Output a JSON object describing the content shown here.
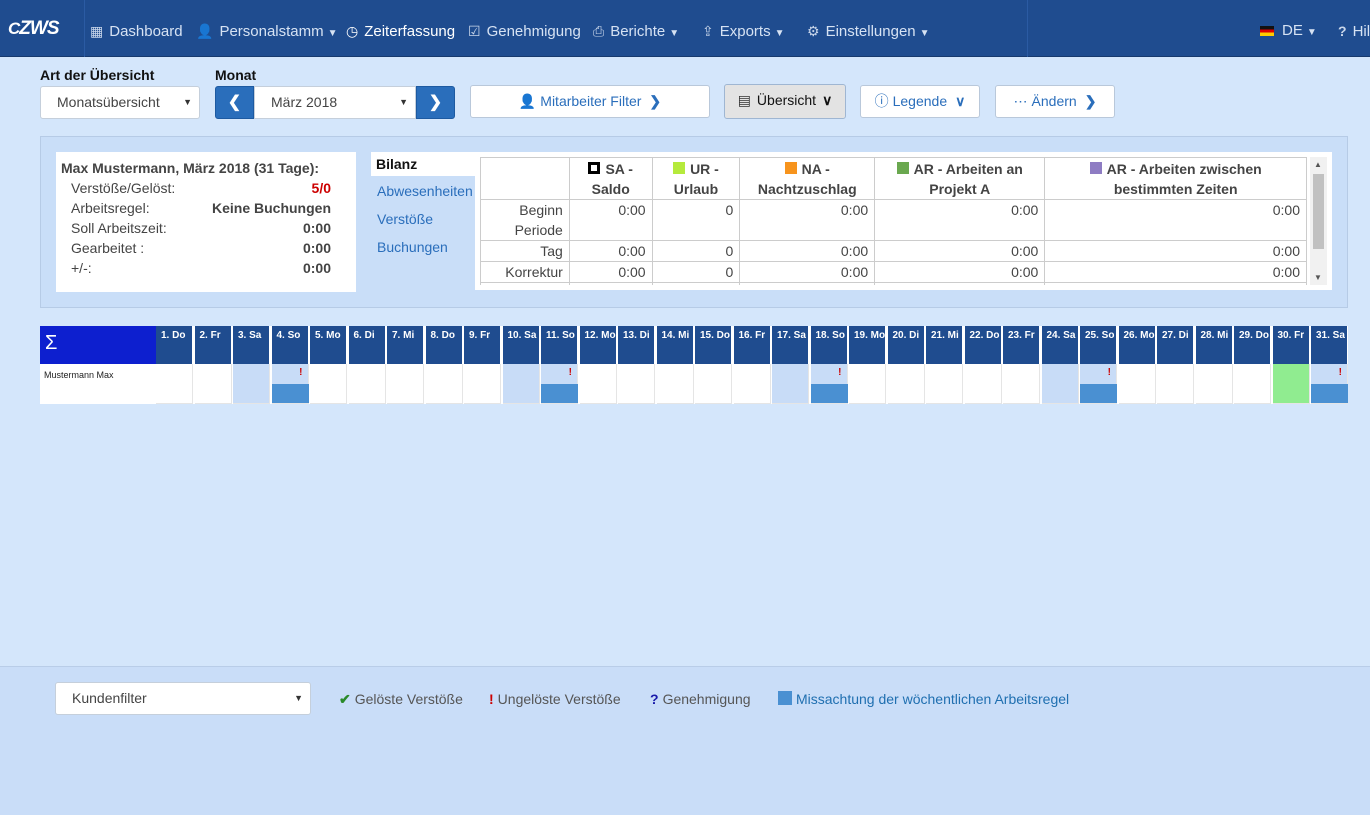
{
  "nav": {
    "brand": "ZWS",
    "items": [
      {
        "label": "Dashboard",
        "icon": "grid-icon"
      },
      {
        "label": "Personalstamm",
        "icon": "user-icon"
      },
      {
        "label": "Zeiterfassung",
        "icon": "clock-icon"
      },
      {
        "label": "Genehmigung",
        "icon": "check-square-icon"
      },
      {
        "label": "Berichte",
        "icon": "printer-icon"
      },
      {
        "label": "Exports",
        "icon": "export-icon"
      },
      {
        "label": "Einstellungen",
        "icon": "gear-icon"
      }
    ],
    "language": "DE",
    "help": "Hil"
  },
  "filters": {
    "art_label": "Art der Übersicht",
    "art_value": "Monatsübersicht",
    "monat_label": "Monat",
    "monat_value": "März 2018",
    "mitarbeiter_filter": "Mitarbeiter Filter",
    "uebersicht": "Übersicht",
    "legende": "Legende",
    "aendern": "Ändern"
  },
  "summary": {
    "head": "Max Mustermann, März 2018 (31 Tage):",
    "rows": [
      {
        "label": "Verstöße/Gelöst:",
        "value": "5/0"
      },
      {
        "label": "Arbeitsregel:",
        "value": "Keine Buchungen"
      },
      {
        "label": "Soll Arbeitszeit:",
        "value": "0:00"
      },
      {
        "label": "Gearbeitet :",
        "value": "0:00"
      },
      {
        "label": "+/-:",
        "value": "0:00"
      }
    ]
  },
  "tabs": [
    "Bilanz",
    "Abwesenheiten",
    "Verstöße",
    "Buchungen"
  ],
  "bilanz": {
    "headers": [
      {
        "line1": "SA -",
        "line2": "Saldo",
        "color": "#ffffff"
      },
      {
        "line1": "UR -",
        "line2": "Urlaub",
        "color": "#b5ea3c"
      },
      {
        "line1": "NA -",
        "line2": "Nachtzuschlag",
        "color": "#f7941d"
      },
      {
        "line1": "AR - Arbeiten an",
        "line2": "Projekt A",
        "color": "#6aa84f"
      },
      {
        "line1": "AR - Arbeiten zwischen",
        "line2": "bestimmten Zeiten",
        "color": "#8e7cc3"
      }
    ],
    "rows": [
      {
        "label1": "Beginn",
        "label2": "Periode",
        "values": [
          "0:00",
          "0",
          "0:00",
          "0:00",
          "0:00"
        ]
      },
      {
        "label1": "Tag",
        "label2": "",
        "values": [
          "0:00",
          "0",
          "0:00",
          "0:00",
          "0:00"
        ]
      },
      {
        "label1": "Korrektur",
        "label2": "",
        "values": [
          "0:00",
          "0",
          "0:00",
          "0:00",
          "0:00"
        ]
      }
    ]
  },
  "calendar": {
    "sigma": "Σ",
    "employee": "Mustermann Max",
    "days": [
      "1. Do",
      "2. Fr",
      "3. Sa",
      "4. So",
      "5. Mo",
      "6. Di",
      "7. Mi",
      "8. Do",
      "9. Fr",
      "10. Sa",
      "11. So",
      "12. Mo",
      "13. Di",
      "14. Mi",
      "15. Do",
      "16. Fr",
      "17. Sa",
      "18. So",
      "19. Mo",
      "20. Di",
      "21. Mi",
      "22. Do",
      "23. Fr",
      "24. Sa",
      "25. So",
      "26. Mo",
      "27. Di",
      "28. Mi",
      "29. Do",
      "30. Fr",
      "31. Sa"
    ],
    "weekend_days": [
      3,
      10,
      17,
      24,
      31
    ],
    "violation_days": [
      4,
      11,
      18,
      25,
      31
    ],
    "green_days": [
      30
    ]
  },
  "footer": {
    "kundenfilter": "Kundenfilter",
    "legend": [
      {
        "symbol": "✔",
        "label": "Gelöste Verstöße",
        "color": "#2a8a2a"
      },
      {
        "symbol": "!",
        "label": "Ungelöste Verstöße",
        "color": "#cc0000"
      },
      {
        "symbol": "?",
        "label": "Genehmigung",
        "color": "#1a1aaa"
      },
      {
        "symbol": "■",
        "label": "Missachtung der wöchentlichen Arbeitsregel",
        "color": "#4a90d2"
      }
    ]
  }
}
